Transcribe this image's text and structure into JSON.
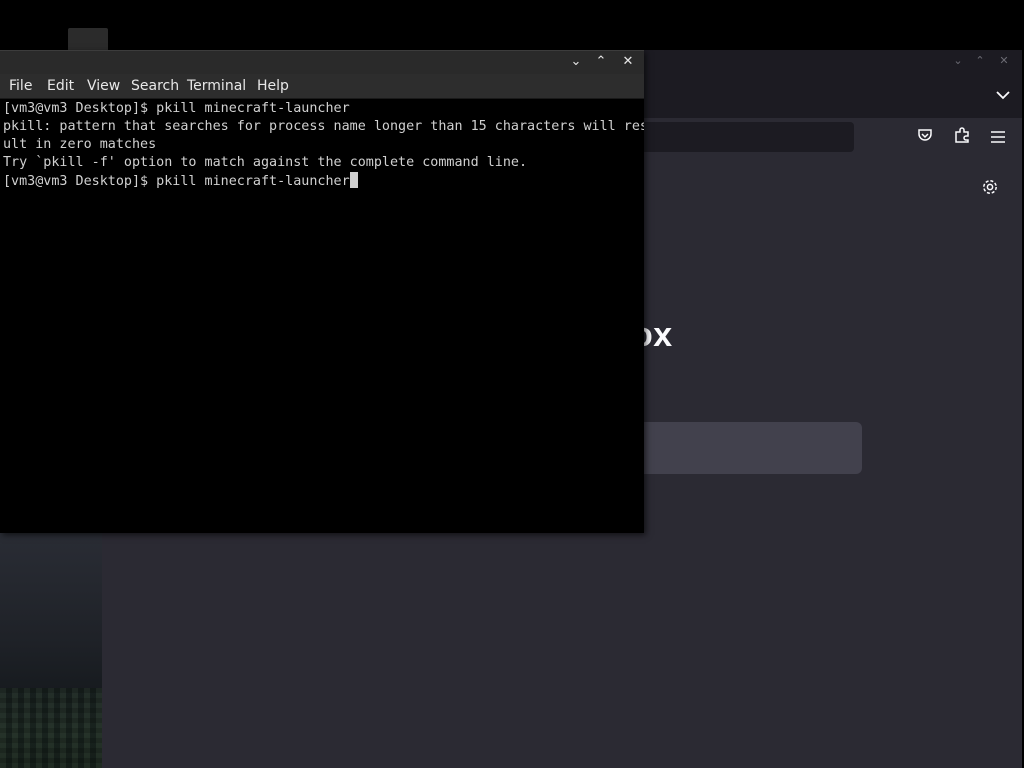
{
  "firefox": {
    "brand_partial": "ox",
    "window_controls": [
      "chevron-down-icon",
      "chevron-up-icon",
      "close-icon"
    ],
    "icons": [
      "tab-list-icon",
      "pocket-icon",
      "extensions-icon",
      "menu-icon",
      "settings-icon"
    ]
  },
  "terminal": {
    "window_controls": {
      "minimize": "⌄",
      "maximize": "⌃",
      "close": "✕"
    },
    "menu": {
      "file": "File",
      "edit": "Edit",
      "view": "View",
      "search": "Search",
      "terminal": "Terminal",
      "help": "Help"
    },
    "lines": [
      "[vm3@vm3 Desktop]$ pkill minecraft-launcher",
      "pkill: pattern that searches for process name longer than 15 characters will res",
      "ult in zero matches",
      "Try `pkill -f' option to match against the complete command line.",
      "[vm3@vm3 Desktop]$ pkill minecraft-launcher"
    ]
  }
}
